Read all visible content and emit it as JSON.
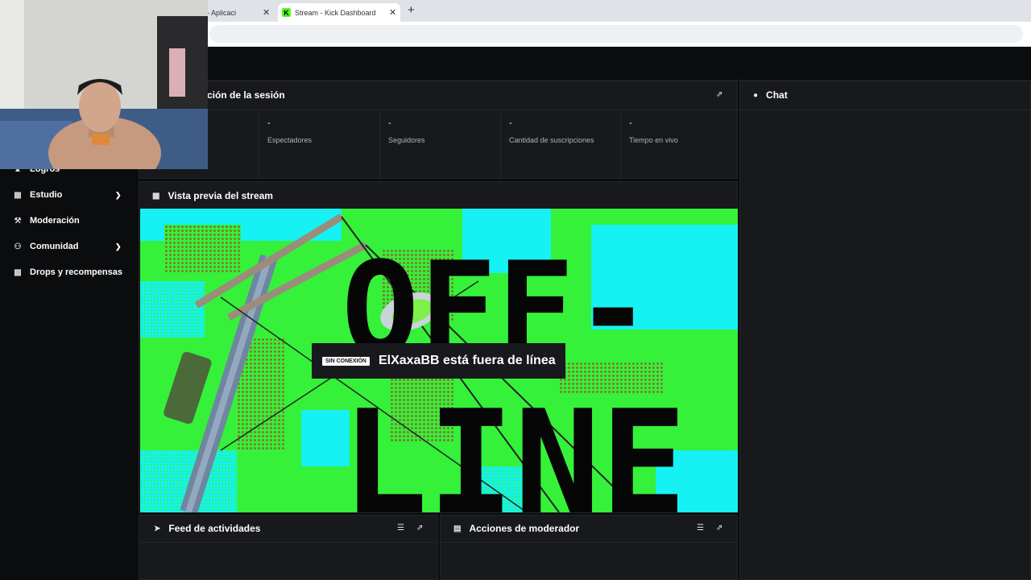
{
  "browser": {
    "tabs": [
      {
        "label": "aming - Aplicaci"
      },
      {
        "label": "Stream - Kick Dashboard",
        "favicon": "K"
      }
    ],
    "new_tab_symbol": "+",
    "close_symbol": "✕"
  },
  "sidebar": {
    "items": [
      {
        "label": "Logros",
        "icon": "trophy-icon"
      },
      {
        "label": "Estudio",
        "icon": "studio-icon",
        "expandable": true
      },
      {
        "label": "Moderación",
        "icon": "wrench-icon"
      },
      {
        "label": "Comunidad",
        "icon": "community-icon",
        "expandable": true
      },
      {
        "label": "Drops y recompensas",
        "icon": "drops-icon"
      }
    ]
  },
  "session": {
    "title": "ción de la sesión",
    "stats": [
      {
        "value": "-",
        "label": "Espectadores"
      },
      {
        "value": "-",
        "label": "Seguidores"
      },
      {
        "value": "-",
        "label": "Cantidad de suscripciones"
      },
      {
        "value": "-",
        "label": "Tiempo en vivo"
      }
    ]
  },
  "preview": {
    "title": "Vista previa del stream",
    "offline_badge": "SIN CONEXIÓN",
    "offline_message": "ElXaxaBB está fuera de línea",
    "artwork_text_line1": "OFF-",
    "artwork_text_line2": "LINE"
  },
  "feed": {
    "title": "Feed de actividades"
  },
  "moderator": {
    "title": "Acciones de moderador"
  },
  "chat": {
    "title": "Chat"
  },
  "colors": {
    "background": "#0b0c0e",
    "panel": "#18191c",
    "kick_green": "#53fc18",
    "offline_green": "#35f13a",
    "offline_cyan": "#16f1f4"
  }
}
